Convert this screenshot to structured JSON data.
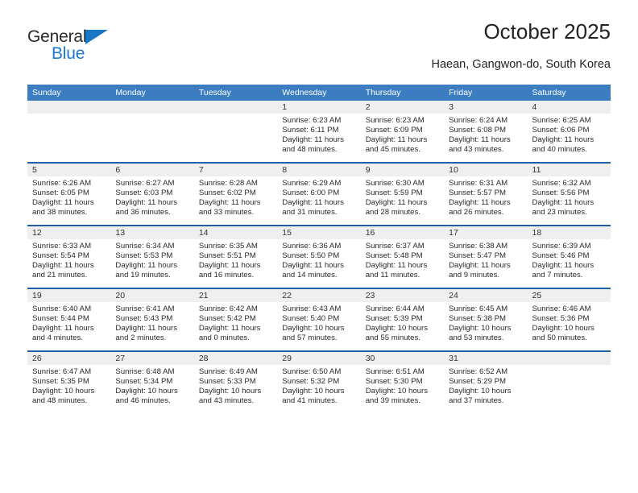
{
  "brand": {
    "name_part1": "General",
    "name_part2": "Blue",
    "accent_color": "#1876c8"
  },
  "header": {
    "title": "October 2025",
    "location": "Haean, Gangwon-do, South Korea"
  },
  "theme": {
    "header_blue": "#3b7dc0",
    "separator_blue": "#1f5fa8",
    "daynum_band": "#efefef"
  },
  "weekdays": [
    "Sunday",
    "Monday",
    "Tuesday",
    "Wednesday",
    "Thursday",
    "Friday",
    "Saturday"
  ],
  "weeks": [
    {
      "days": [
        {
          "num": "",
          "sunrise": "",
          "sunset": "",
          "daylight1": "",
          "daylight2": "",
          "empty": true
        },
        {
          "num": "",
          "sunrise": "",
          "sunset": "",
          "daylight1": "",
          "daylight2": "",
          "empty": true
        },
        {
          "num": "",
          "sunrise": "",
          "sunset": "",
          "daylight1": "",
          "daylight2": "",
          "empty": true
        },
        {
          "num": "1",
          "sunrise": "Sunrise: 6:23 AM",
          "sunset": "Sunset: 6:11 PM",
          "daylight1": "Daylight: 11 hours",
          "daylight2": "and 48 minutes."
        },
        {
          "num": "2",
          "sunrise": "Sunrise: 6:23 AM",
          "sunset": "Sunset: 6:09 PM",
          "daylight1": "Daylight: 11 hours",
          "daylight2": "and 45 minutes."
        },
        {
          "num": "3",
          "sunrise": "Sunrise: 6:24 AM",
          "sunset": "Sunset: 6:08 PM",
          "daylight1": "Daylight: 11 hours",
          "daylight2": "and 43 minutes."
        },
        {
          "num": "4",
          "sunrise": "Sunrise: 6:25 AM",
          "sunset": "Sunset: 6:06 PM",
          "daylight1": "Daylight: 11 hours",
          "daylight2": "and 40 minutes."
        }
      ]
    },
    {
      "days": [
        {
          "num": "5",
          "sunrise": "Sunrise: 6:26 AM",
          "sunset": "Sunset: 6:05 PM",
          "daylight1": "Daylight: 11 hours",
          "daylight2": "and 38 minutes."
        },
        {
          "num": "6",
          "sunrise": "Sunrise: 6:27 AM",
          "sunset": "Sunset: 6:03 PM",
          "daylight1": "Daylight: 11 hours",
          "daylight2": "and 36 minutes."
        },
        {
          "num": "7",
          "sunrise": "Sunrise: 6:28 AM",
          "sunset": "Sunset: 6:02 PM",
          "daylight1": "Daylight: 11 hours",
          "daylight2": "and 33 minutes."
        },
        {
          "num": "8",
          "sunrise": "Sunrise: 6:29 AM",
          "sunset": "Sunset: 6:00 PM",
          "daylight1": "Daylight: 11 hours",
          "daylight2": "and 31 minutes."
        },
        {
          "num": "9",
          "sunrise": "Sunrise: 6:30 AM",
          "sunset": "Sunset: 5:59 PM",
          "daylight1": "Daylight: 11 hours",
          "daylight2": "and 28 minutes."
        },
        {
          "num": "10",
          "sunrise": "Sunrise: 6:31 AM",
          "sunset": "Sunset: 5:57 PM",
          "daylight1": "Daylight: 11 hours",
          "daylight2": "and 26 minutes."
        },
        {
          "num": "11",
          "sunrise": "Sunrise: 6:32 AM",
          "sunset": "Sunset: 5:56 PM",
          "daylight1": "Daylight: 11 hours",
          "daylight2": "and 23 minutes."
        }
      ]
    },
    {
      "days": [
        {
          "num": "12",
          "sunrise": "Sunrise: 6:33 AM",
          "sunset": "Sunset: 5:54 PM",
          "daylight1": "Daylight: 11 hours",
          "daylight2": "and 21 minutes."
        },
        {
          "num": "13",
          "sunrise": "Sunrise: 6:34 AM",
          "sunset": "Sunset: 5:53 PM",
          "daylight1": "Daylight: 11 hours",
          "daylight2": "and 19 minutes."
        },
        {
          "num": "14",
          "sunrise": "Sunrise: 6:35 AM",
          "sunset": "Sunset: 5:51 PM",
          "daylight1": "Daylight: 11 hours",
          "daylight2": "and 16 minutes."
        },
        {
          "num": "15",
          "sunrise": "Sunrise: 6:36 AM",
          "sunset": "Sunset: 5:50 PM",
          "daylight1": "Daylight: 11 hours",
          "daylight2": "and 14 minutes."
        },
        {
          "num": "16",
          "sunrise": "Sunrise: 6:37 AM",
          "sunset": "Sunset: 5:48 PM",
          "daylight1": "Daylight: 11 hours",
          "daylight2": "and 11 minutes."
        },
        {
          "num": "17",
          "sunrise": "Sunrise: 6:38 AM",
          "sunset": "Sunset: 5:47 PM",
          "daylight1": "Daylight: 11 hours",
          "daylight2": "and 9 minutes."
        },
        {
          "num": "18",
          "sunrise": "Sunrise: 6:39 AM",
          "sunset": "Sunset: 5:46 PM",
          "daylight1": "Daylight: 11 hours",
          "daylight2": "and 7 minutes."
        }
      ]
    },
    {
      "days": [
        {
          "num": "19",
          "sunrise": "Sunrise: 6:40 AM",
          "sunset": "Sunset: 5:44 PM",
          "daylight1": "Daylight: 11 hours",
          "daylight2": "and 4 minutes."
        },
        {
          "num": "20",
          "sunrise": "Sunrise: 6:41 AM",
          "sunset": "Sunset: 5:43 PM",
          "daylight1": "Daylight: 11 hours",
          "daylight2": "and 2 minutes."
        },
        {
          "num": "21",
          "sunrise": "Sunrise: 6:42 AM",
          "sunset": "Sunset: 5:42 PM",
          "daylight1": "Daylight: 11 hours",
          "daylight2": "and 0 minutes."
        },
        {
          "num": "22",
          "sunrise": "Sunrise: 6:43 AM",
          "sunset": "Sunset: 5:40 PM",
          "daylight1": "Daylight: 10 hours",
          "daylight2": "and 57 minutes."
        },
        {
          "num": "23",
          "sunrise": "Sunrise: 6:44 AM",
          "sunset": "Sunset: 5:39 PM",
          "daylight1": "Daylight: 10 hours",
          "daylight2": "and 55 minutes."
        },
        {
          "num": "24",
          "sunrise": "Sunrise: 6:45 AM",
          "sunset": "Sunset: 5:38 PM",
          "daylight1": "Daylight: 10 hours",
          "daylight2": "and 53 minutes."
        },
        {
          "num": "25",
          "sunrise": "Sunrise: 6:46 AM",
          "sunset": "Sunset: 5:36 PM",
          "daylight1": "Daylight: 10 hours",
          "daylight2": "and 50 minutes."
        }
      ]
    },
    {
      "days": [
        {
          "num": "26",
          "sunrise": "Sunrise: 6:47 AM",
          "sunset": "Sunset: 5:35 PM",
          "daylight1": "Daylight: 10 hours",
          "daylight2": "and 48 minutes."
        },
        {
          "num": "27",
          "sunrise": "Sunrise: 6:48 AM",
          "sunset": "Sunset: 5:34 PM",
          "daylight1": "Daylight: 10 hours",
          "daylight2": "and 46 minutes."
        },
        {
          "num": "28",
          "sunrise": "Sunrise: 6:49 AM",
          "sunset": "Sunset: 5:33 PM",
          "daylight1": "Daylight: 10 hours",
          "daylight2": "and 43 minutes."
        },
        {
          "num": "29",
          "sunrise": "Sunrise: 6:50 AM",
          "sunset": "Sunset: 5:32 PM",
          "daylight1": "Daylight: 10 hours",
          "daylight2": "and 41 minutes."
        },
        {
          "num": "30",
          "sunrise": "Sunrise: 6:51 AM",
          "sunset": "Sunset: 5:30 PM",
          "daylight1": "Daylight: 10 hours",
          "daylight2": "and 39 minutes."
        },
        {
          "num": "31",
          "sunrise": "Sunrise: 6:52 AM",
          "sunset": "Sunset: 5:29 PM",
          "daylight1": "Daylight: 10 hours",
          "daylight2": "and 37 minutes."
        },
        {
          "num": "",
          "sunrise": "",
          "sunset": "",
          "daylight1": "",
          "daylight2": "",
          "empty": true
        }
      ]
    }
  ]
}
